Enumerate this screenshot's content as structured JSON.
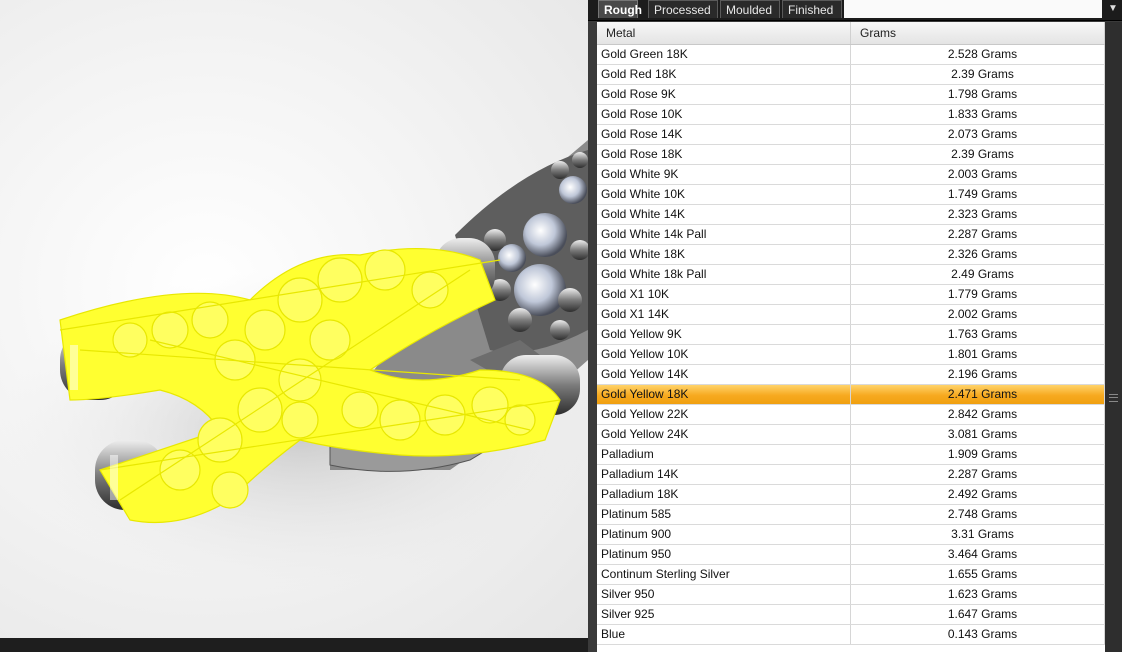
{
  "tabs": [
    {
      "label": "Rough",
      "active": true
    },
    {
      "label": "Processed",
      "active": false
    },
    {
      "label": "Moulded",
      "active": false
    },
    {
      "label": "Finished",
      "active": false
    }
  ],
  "grid": {
    "columns": [
      "Metal",
      "Grams"
    ],
    "selected_metal": "Gold Yellow 18K",
    "selection_color": "#f7a91f",
    "rows": [
      {
        "metal": "Gold Green 18K",
        "grams": "2.528 Grams"
      },
      {
        "metal": "Gold Red 18K",
        "grams": "2.39 Grams"
      },
      {
        "metal": "Gold Rose 9K",
        "grams": "1.798 Grams"
      },
      {
        "metal": "Gold Rose 10K",
        "grams": "1.833 Grams"
      },
      {
        "metal": "Gold Rose 14K",
        "grams": "2.073 Grams"
      },
      {
        "metal": "Gold Rose 18K",
        "grams": "2.39 Grams"
      },
      {
        "metal": "Gold White 9K",
        "grams": "2.003 Grams"
      },
      {
        "metal": "Gold White 10K",
        "grams": "1.749 Grams"
      },
      {
        "metal": "Gold White 14K",
        "grams": "2.323 Grams"
      },
      {
        "metal": "Gold White 14k Pall",
        "grams": "2.287 Grams"
      },
      {
        "metal": "Gold White 18K",
        "grams": "2.326 Grams"
      },
      {
        "metal": "Gold White 18k Pall",
        "grams": "2.49 Grams"
      },
      {
        "metal": "Gold X1 10K",
        "grams": "1.779 Grams"
      },
      {
        "metal": "Gold X1 14K",
        "grams": "2.002 Grams"
      },
      {
        "metal": "Gold Yellow 9K",
        "grams": "1.763 Grams"
      },
      {
        "metal": "Gold Yellow 10K",
        "grams": "1.801 Grams"
      },
      {
        "metal": "Gold Yellow 14K",
        "grams": "2.196 Grams"
      },
      {
        "metal": "Gold Yellow 18K",
        "grams": "2.471 Grams"
      },
      {
        "metal": "Gold Yellow 22K",
        "grams": "2.842 Grams"
      },
      {
        "metal": "Gold Yellow 24K",
        "grams": "3.081 Grams"
      },
      {
        "metal": "Palladium",
        "grams": "1.909 Grams"
      },
      {
        "metal": "Palladium 14K",
        "grams": "2.287 Grams"
      },
      {
        "metal": "Palladium 18K",
        "grams": "2.492 Grams"
      },
      {
        "metal": "Platinum 585",
        "grams": "2.748 Grams"
      },
      {
        "metal": "Platinum 900",
        "grams": "3.31 Grams"
      },
      {
        "metal": "Platinum 950",
        "grams": "3.464 Grams"
      },
      {
        "metal": "Continum Sterling Silver",
        "grams": "1.655 Grams"
      },
      {
        "metal": "Silver 950",
        "grams": "1.623 Grams"
      },
      {
        "metal": "Silver 925",
        "grams": "1.647 Grams"
      },
      {
        "metal": "Blue",
        "grams": "0.143 Grams"
      }
    ]
  },
  "icons": {
    "tab_menu": "chevron-down-icon",
    "scroll_grip": "grip-icon"
  },
  "viewport": {
    "highlight_color": "#ffff00",
    "background_color": "#f4f4f4"
  }
}
